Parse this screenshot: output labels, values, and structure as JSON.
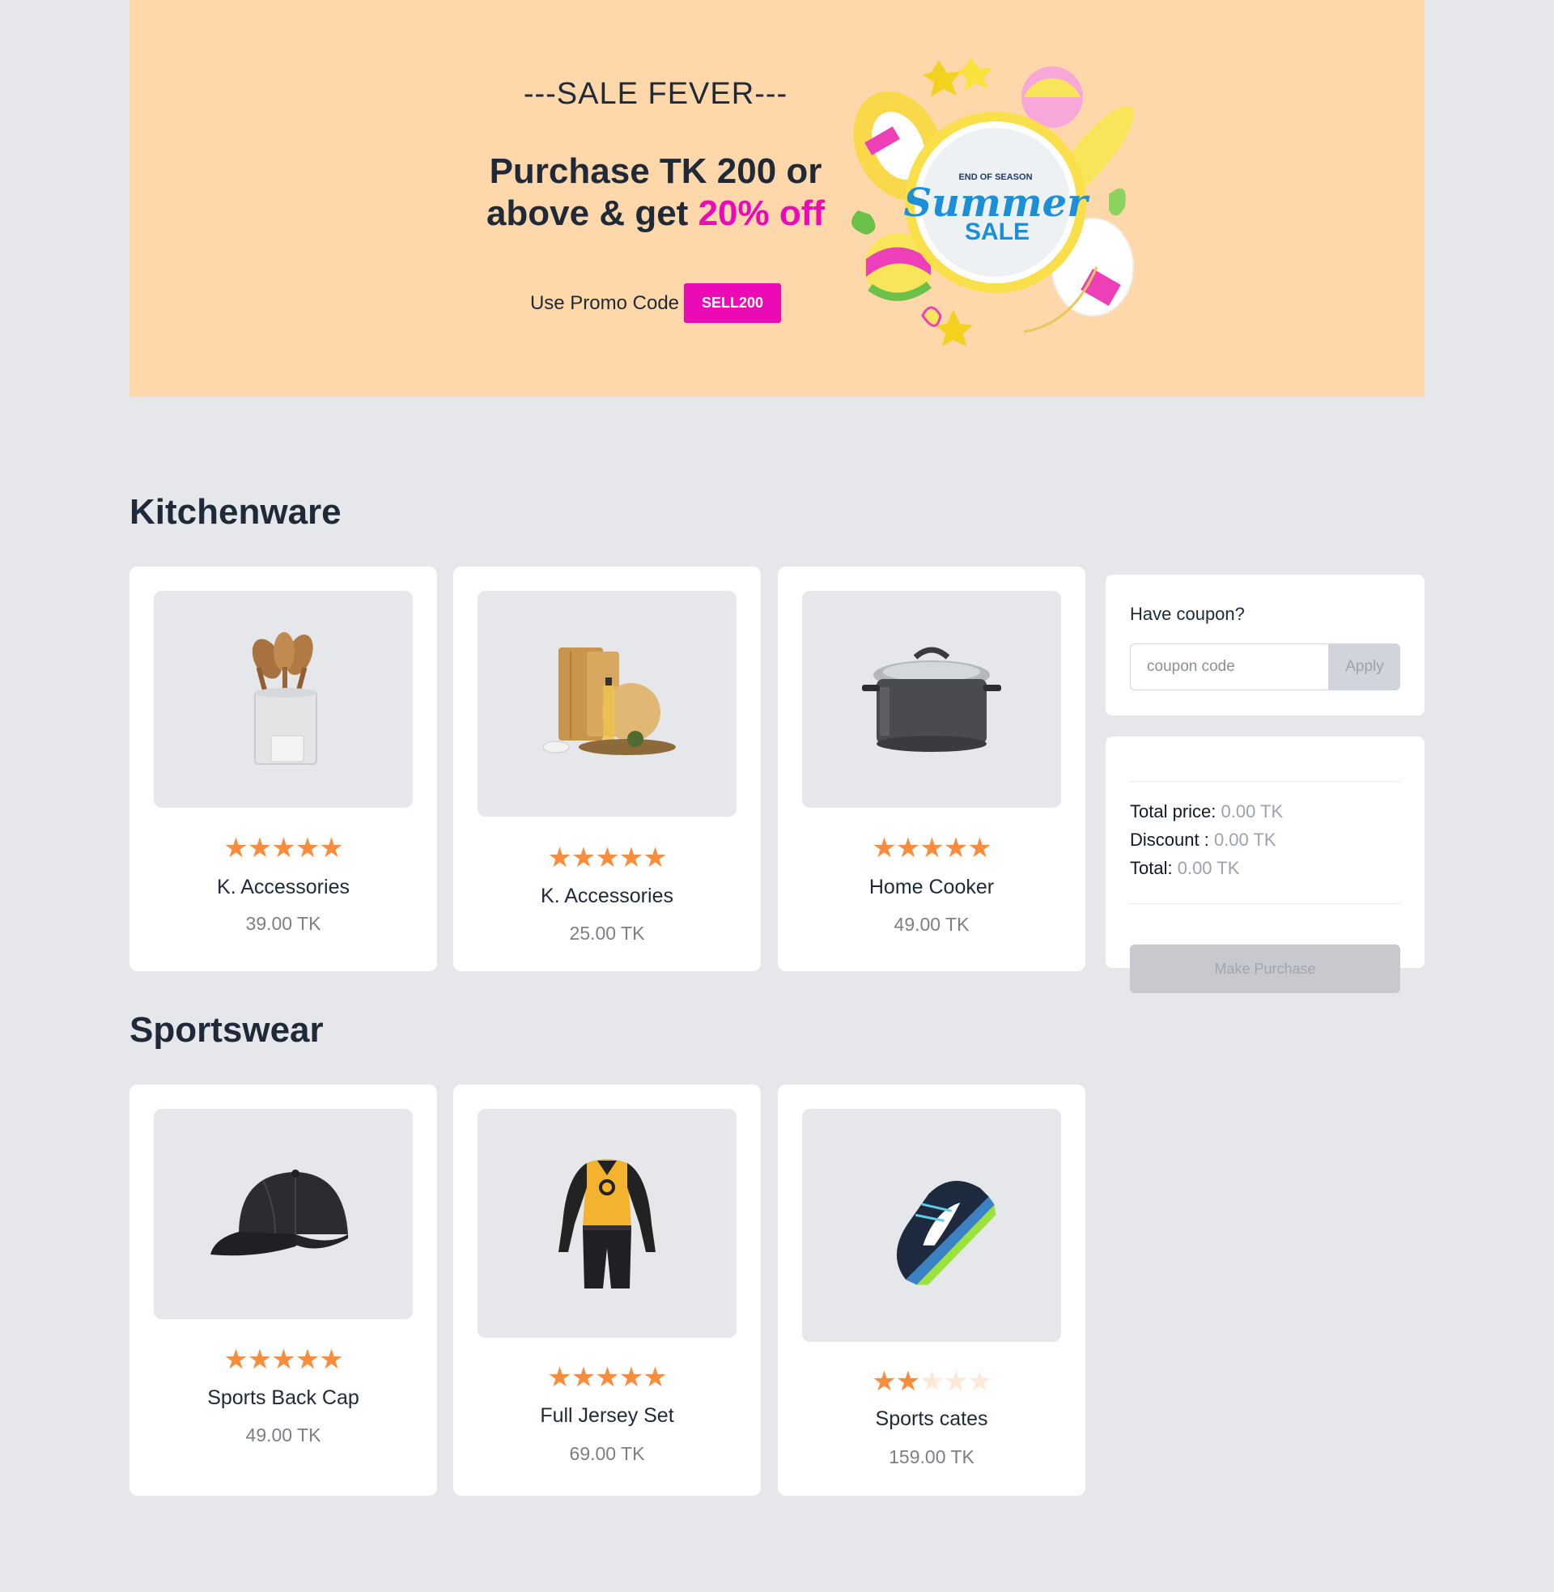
{
  "banner": {
    "kicker": "---SALE FEVER---",
    "headline_1": "Purchase TK 200 or",
    "headline_2a": "above & get ",
    "headline_2b": "20% off",
    "promo_label": "Use Promo Code",
    "promo_code": "SELL200",
    "art_top": "END OF SEASON",
    "art_script": "Summer",
    "art_sale": "SALE",
    "accent_color": "#ec09b6"
  },
  "sections": {
    "kitchen_title": "Kitchenware",
    "sports_title": "Sportswear"
  },
  "products": {
    "p1": {
      "name": "K. Accessories",
      "price": "39.00 TK",
      "rating": 5,
      "icon": "utensils-holder"
    },
    "p2": {
      "name": "K. Accessories",
      "price": "25.00 TK",
      "rating": 5,
      "icon": "cutting-boards"
    },
    "p3": {
      "name": "Home Cooker",
      "price": "49.00 TK",
      "rating": 5,
      "icon": "cooking-pot"
    },
    "p4": {
      "name": "Sports Back Cap",
      "price": "49.00 TK",
      "rating": 5,
      "icon": "baseball-cap"
    },
    "p5": {
      "name": "Full Jersey Set",
      "price": "69.00 TK",
      "rating": 5,
      "icon": "jersey"
    },
    "p6": {
      "name": "Sports cates",
      "price": "159.00 TK",
      "rating": 2,
      "icon": "sneaker"
    }
  },
  "coupon": {
    "label": "Have coupon?",
    "placeholder": "coupon code",
    "apply": "Apply"
  },
  "summary": {
    "total_price_label": "Total price:",
    "total_price": "0.00 TK",
    "discount_label": "Discount :",
    "discount": "0.00 TK",
    "total_label": "Total:",
    "total": "0.00 TK",
    "purchase": "Make Purchase"
  },
  "colors": {
    "banner_bg": "#fed7aa",
    "star": "#fb8c3c",
    "page_bg": "#e5e7eb"
  }
}
